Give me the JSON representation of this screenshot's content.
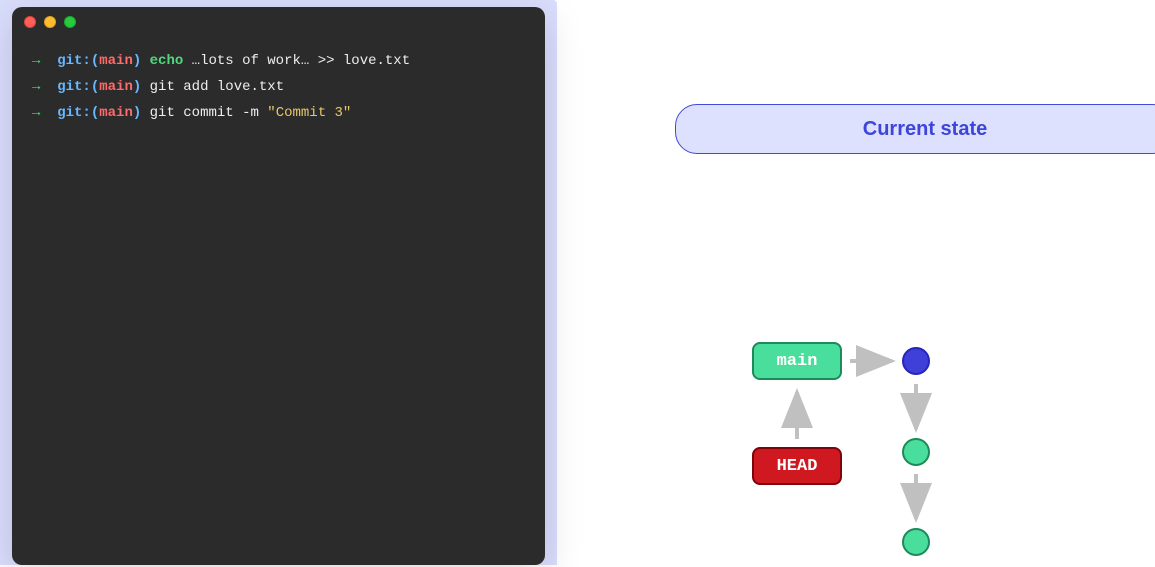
{
  "terminal": {
    "lines": [
      {
        "arrow": "→",
        "git": "git:",
        "paren_open": "(",
        "branch": "main",
        "paren_close": ")",
        "cmd": "echo",
        "args": "…lots of work… >> love.txt",
        "type": "echo"
      },
      {
        "arrow": "→",
        "git": "git:",
        "paren_open": "(",
        "branch": "main",
        "paren_close": ")",
        "cmd": "git",
        "args": "add love.txt",
        "type": "plain"
      },
      {
        "arrow": "→",
        "git": "git:",
        "paren_open": "(",
        "branch": "main",
        "paren_close": ")",
        "cmd": "git",
        "args_prefix": "commit -m ",
        "string": "\"Commit 3\"",
        "type": "string"
      }
    ]
  },
  "state_label": "Current state",
  "diagram": {
    "main_label": "main",
    "head_label": "HEAD"
  }
}
